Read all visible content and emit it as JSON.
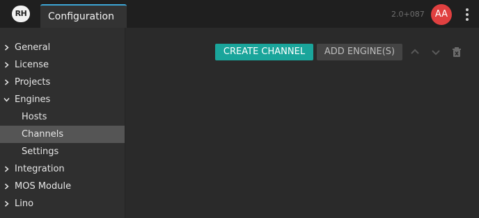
{
  "app": {
    "logo_text": "RH",
    "version": "2.0+087"
  },
  "tabs": [
    {
      "label": "Configuration"
    }
  ],
  "user": {
    "initials": "AA",
    "avatar_color": "#e04040"
  },
  "sidebar": {
    "items": [
      {
        "label": "General",
        "expanded": false
      },
      {
        "label": "License",
        "expanded": false
      },
      {
        "label": "Projects",
        "expanded": false
      },
      {
        "label": "Engines",
        "expanded": true
      },
      {
        "label": "Hosts"
      },
      {
        "label": "Channels",
        "selected": true
      },
      {
        "label": "Settings"
      },
      {
        "label": "Integration",
        "expanded": false
      },
      {
        "label": "MOS Module",
        "expanded": false
      },
      {
        "label": "Lino",
        "expanded": false
      }
    ]
  },
  "toolbar": {
    "create_label": "CREATE CHANNEL",
    "add_label": "ADD ENGINE(S)",
    "move_up_icon": "chevron-up-icon",
    "move_down_icon": "chevron-down-icon",
    "delete_icon": "trash-icon"
  },
  "colors": {
    "accent": "#1aa59b",
    "tab_border": "#3da6d6"
  }
}
